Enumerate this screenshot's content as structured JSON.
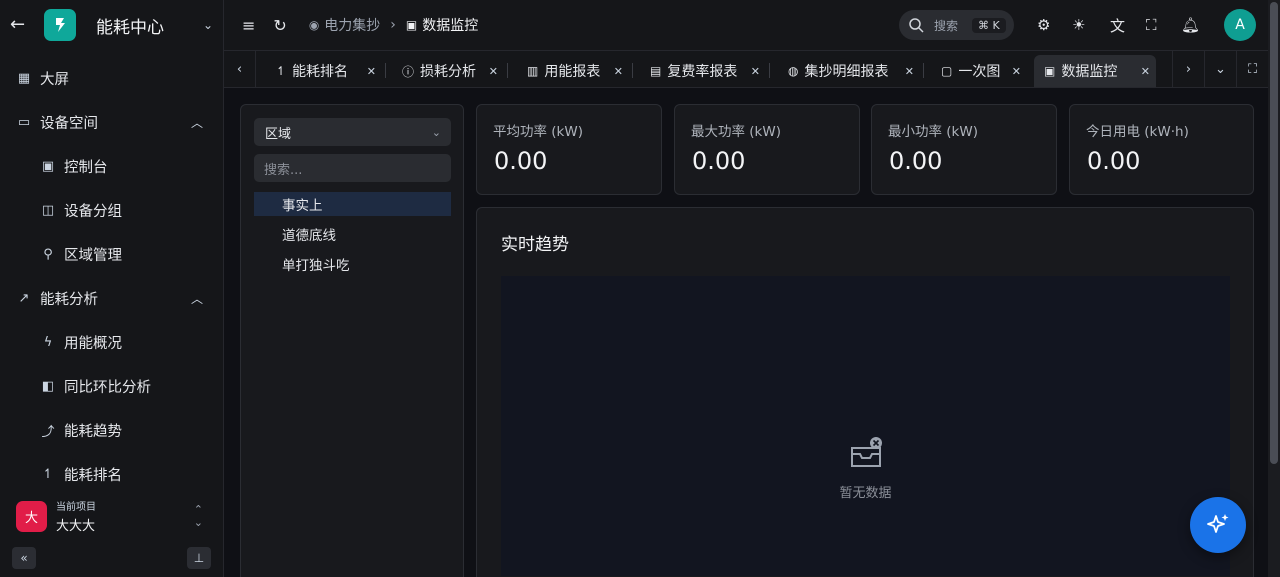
{
  "sidebar": {
    "app_name": "能耗中心",
    "menu": [
      {
        "label": "大屏",
        "icon": "dashboard-icon",
        "level": 0
      },
      {
        "label": "设备空间",
        "icon": "device-icon",
        "level": 0,
        "expanded": true
      },
      {
        "label": "控制台",
        "icon": "console-icon",
        "level": 1
      },
      {
        "label": "设备分组",
        "icon": "group-icon",
        "level": 1
      },
      {
        "label": "区域管理",
        "icon": "location-icon",
        "level": 1
      },
      {
        "label": "能耗分析",
        "icon": "chart-line-icon",
        "level": 0,
        "expanded": true
      },
      {
        "label": "用能概况",
        "icon": "bolt-icon",
        "level": 1
      },
      {
        "label": "同比环比分析",
        "icon": "compare-icon",
        "level": 1
      },
      {
        "label": "能耗趋势",
        "icon": "trend-icon",
        "level": 1
      },
      {
        "label": "能耗排名",
        "icon": "rank-icon",
        "level": 1
      }
    ],
    "project": {
      "caption": "当前项目",
      "name": "大大大",
      "avatar": "大"
    }
  },
  "header": {
    "breadcrumb": [
      "电力集抄",
      "数据监控"
    ],
    "search_placeholder": "搜索",
    "search_shortcut": "⌘ K",
    "user_avatar": "A"
  },
  "tabs": [
    {
      "label": "能耗排名",
      "icon": "rank-icon"
    },
    {
      "label": "损耗分析",
      "icon": "alert-circle-icon"
    },
    {
      "label": "用能报表",
      "icon": "report-icon"
    },
    {
      "label": "复费率报表",
      "icon": "document-icon"
    },
    {
      "label": "集抄明细报表",
      "icon": "detail-icon"
    },
    {
      "label": "一次图",
      "icon": "file-icon"
    },
    {
      "label": "数据监控",
      "icon": "monitor-icon",
      "active": true
    }
  ],
  "tree": {
    "selector": "区域",
    "search_placeholder": "搜索...",
    "nodes": [
      "事实上",
      "道德底线",
      "单打独斗吃"
    ],
    "selected_index": 0
  },
  "stats": [
    {
      "label": "平均功率 (kW)",
      "value": "0.00"
    },
    {
      "label": "最大功率 (kW)",
      "value": "0.00"
    },
    {
      "label": "最小功率 (kW)",
      "value": "0.00"
    },
    {
      "label": "今日用电 (kW·h)",
      "value": "0.00"
    }
  ],
  "trend": {
    "title": "实时趋势",
    "empty_text": "暂无数据"
  },
  "colors": {
    "accent": "#1a73e8",
    "brand": "#0fa89a",
    "project_avatar": "#e11d48"
  }
}
